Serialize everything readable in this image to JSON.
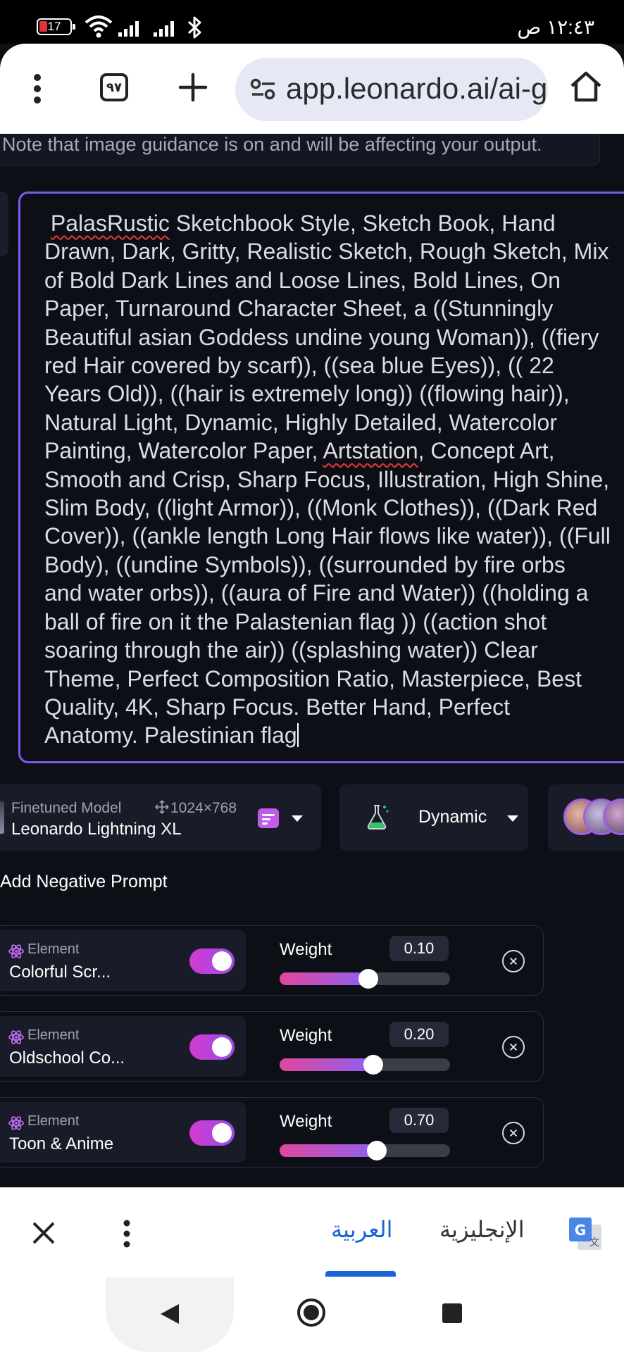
{
  "status_bar": {
    "battery": "17",
    "time": "١٢:٤٣ ص"
  },
  "browser": {
    "tab_count": "٩٧",
    "url": "app.leonardo.ai/ai-generations"
  },
  "notice": "Note that image guidance is on and will be affecting your output.",
  "prompt": {
    "lines": [
      " PalasRustic Sketchbook Style, Sketch Book, Hand",
      "Drawn, Dark, Gritty, Realistic Sketch, Rough Sketch, Mix",
      "of Bold Dark Lines and Loose Lines, Bold Lines, On",
      "Paper, Turnaround Character Sheet, a ((Stunningly",
      "Beautiful asian Goddess undine young Woman)), ((fiery",
      "red Hair covered by scarf)), ((sea blue Eyes)), (( 22",
      "Years Old)), ((hair is extremely long)) ((flowing hair)),",
      "Natural Light, Dynamic, Highly Detailed, Watercolor",
      "Painting, Watercolor Paper, Artstation, Concept Art,",
      "Smooth and Crisp, Sharp Focus, Illustration, High Shine,",
      "Slim Body, ((light Armor)), ((Monk Clothes)), ((Dark Red",
      "Cover)), ((ankle length Long Hair flows like water)), ((Full",
      "Body), ((undine Symbols)), ((surrounded by fire orbs",
      "and water orbs)), ((aura of Fire and Water)) ((holding a",
      "ball of fire on it the Palastenian flag )) ((action shot",
      "soaring through the air)) ((splashing water)) Clear",
      "Theme, Perfect Composition Ratio, Masterpiece, Best",
      "Quality, 4K, Sharp Focus. Better Hand, Perfect",
      "Anatomy. Palestinian flag"
    ]
  },
  "model": {
    "subtitle": "Finetuned Model",
    "dimensions": "1024×768",
    "name": "Leonardo Lightning XL"
  },
  "style": {
    "label": "Dynamic"
  },
  "negative_prompt": "Add Negative Prompt",
  "elements": [
    {
      "type": "Element",
      "name": "Colorful Scr...",
      "weight_label": "Weight",
      "weight": "0.10",
      "level": 0.52
    },
    {
      "type": "Element",
      "name": "Oldschool Co...",
      "weight_label": "Weight",
      "weight": "0.20",
      "level": 0.55
    },
    {
      "type": "Element",
      "name": "Toon & Anime",
      "weight_label": "Weight",
      "weight": "0.70",
      "level": 0.57
    }
  ],
  "translate": {
    "active_lang": "العربية",
    "other_lang": "الإنجليزية"
  },
  "colors": {
    "accent": "#7c5ce6",
    "toggle": "#c050dc",
    "translate_active": "#1a64d6"
  }
}
